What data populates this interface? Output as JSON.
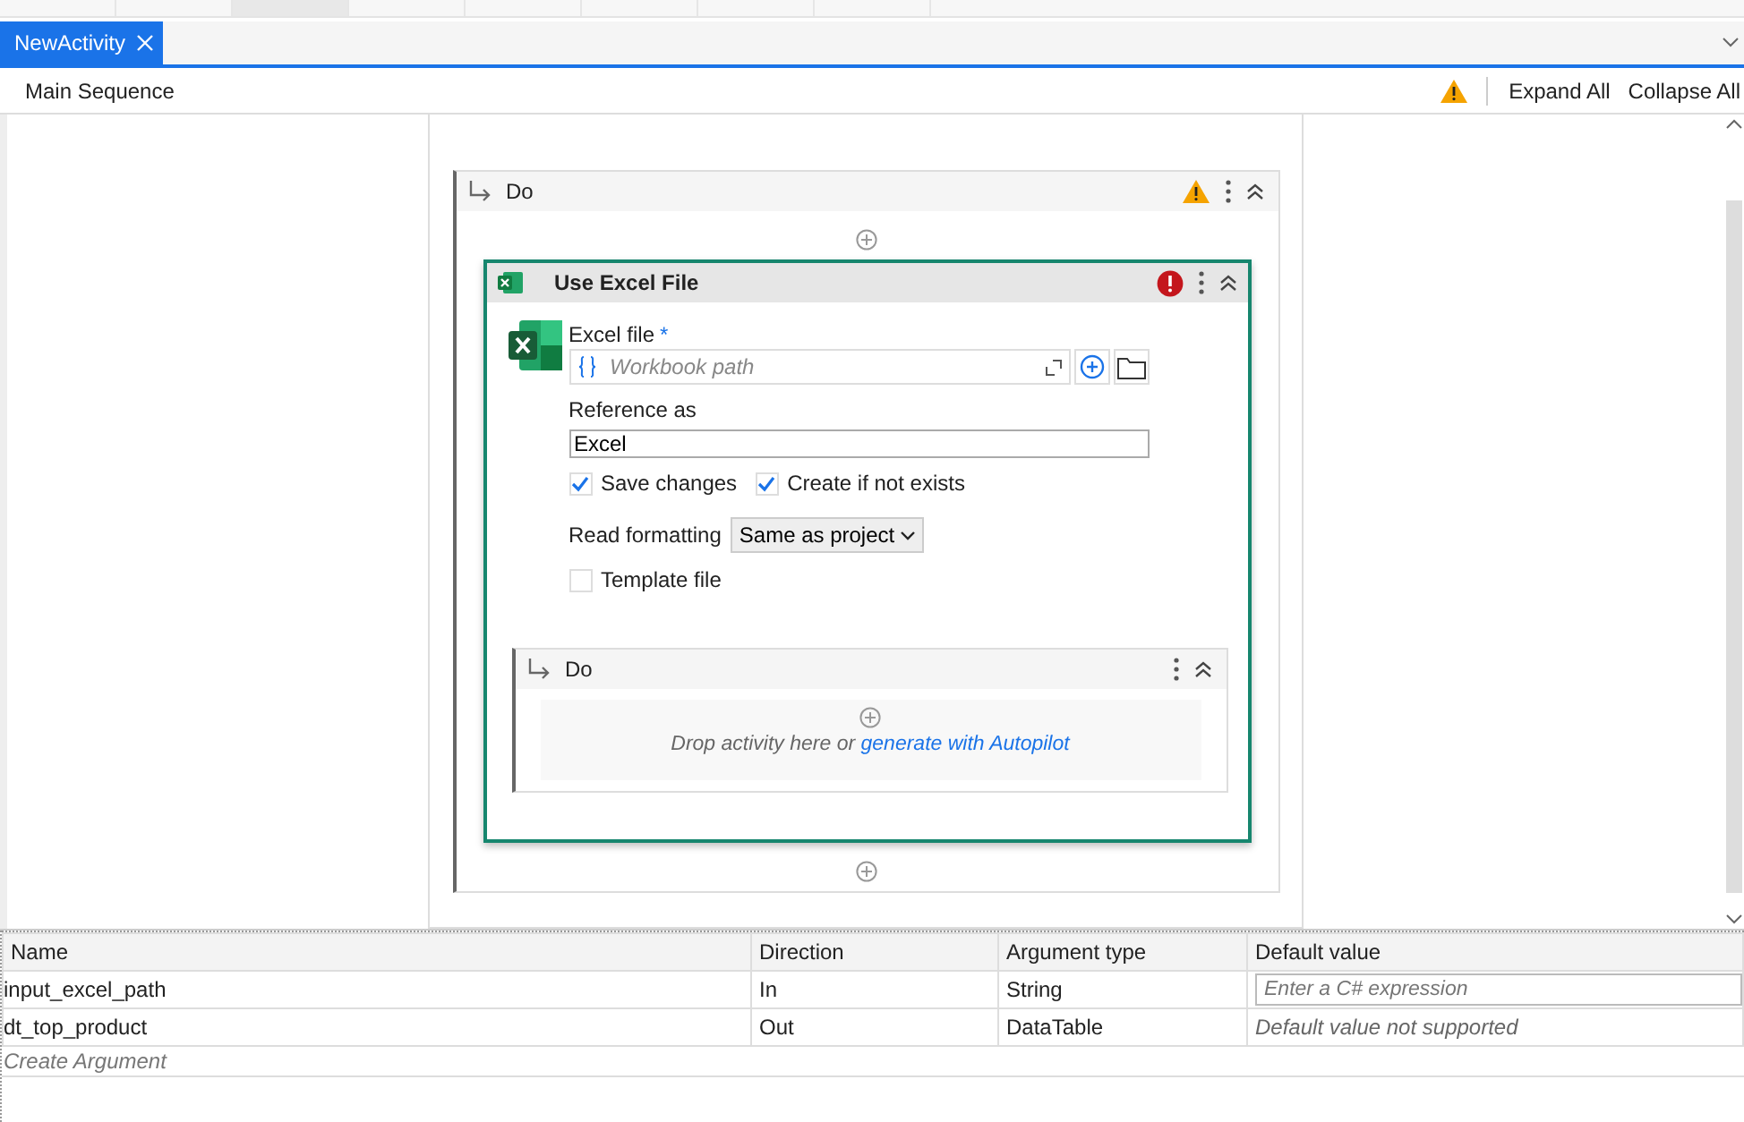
{
  "document_tab": {
    "label": "NewActivity",
    "selected": true
  },
  "toolbar": {
    "title": "Main Sequence",
    "actions": [
      "Expand All",
      "Collapse All"
    ]
  },
  "outer_sequence": {
    "title": "Do"
  },
  "activity": {
    "title": "Use Excel File",
    "file_label": "Excel file",
    "required_mark": "*",
    "file_placeholder": "Workbook path",
    "reference_label": "Reference as",
    "reference_value": "Excel",
    "options": [
      {
        "label": "Save changes",
        "checked": true
      },
      {
        "label": "Create if not exists",
        "checked": true
      }
    ],
    "read_formatting_label": "Read formatting",
    "read_formatting_value": "Same as project",
    "template": {
      "label": "Template file",
      "checked": false
    },
    "inner_sequence": {
      "title": "Do",
      "drop_hint": "Drop activity here or ",
      "drop_link": "generate with Autopilot"
    }
  },
  "arguments": {
    "columns": [
      "Name",
      "Direction",
      "Argument type",
      "Default value"
    ],
    "rows": [
      {
        "name": "input_excel_path",
        "direction": "In",
        "type": "String",
        "default": {
          "kind": "input",
          "placeholder": "Enter a C# expression"
        }
      },
      {
        "name": "dt_top_product",
        "direction": "Out",
        "type": "DataTable",
        "default": {
          "kind": "note",
          "text": "Default value not supported"
        }
      }
    ],
    "create_hint": "Create Argument"
  }
}
